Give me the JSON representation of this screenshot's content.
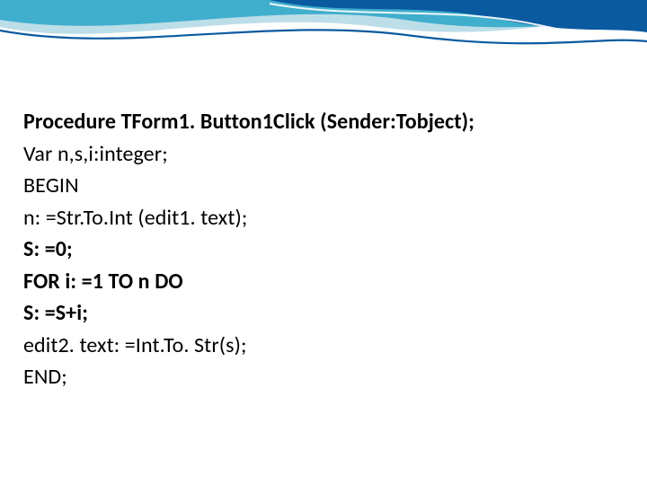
{
  "code": {
    "line1": "Procedure TForm1. Button1Click (Sender:Tobject);",
    "line2": "Var n,s,i:integer;",
    "line3": "BEGIN",
    "line4": "n: =Str.To.Int (edit1. text);",
    "line5": "S: =0;",
    "line6": "FOR i: =1 TO n DO",
    "line7": "S: =S+i;",
    "line8": "edit2. text: =Int.To. Str(s);",
    "line9": "END;"
  },
  "theme": {
    "wave_primary": "#0a5aa0",
    "wave_accent": "#2aa6c8",
    "wave_light": "#9fd0e0"
  }
}
